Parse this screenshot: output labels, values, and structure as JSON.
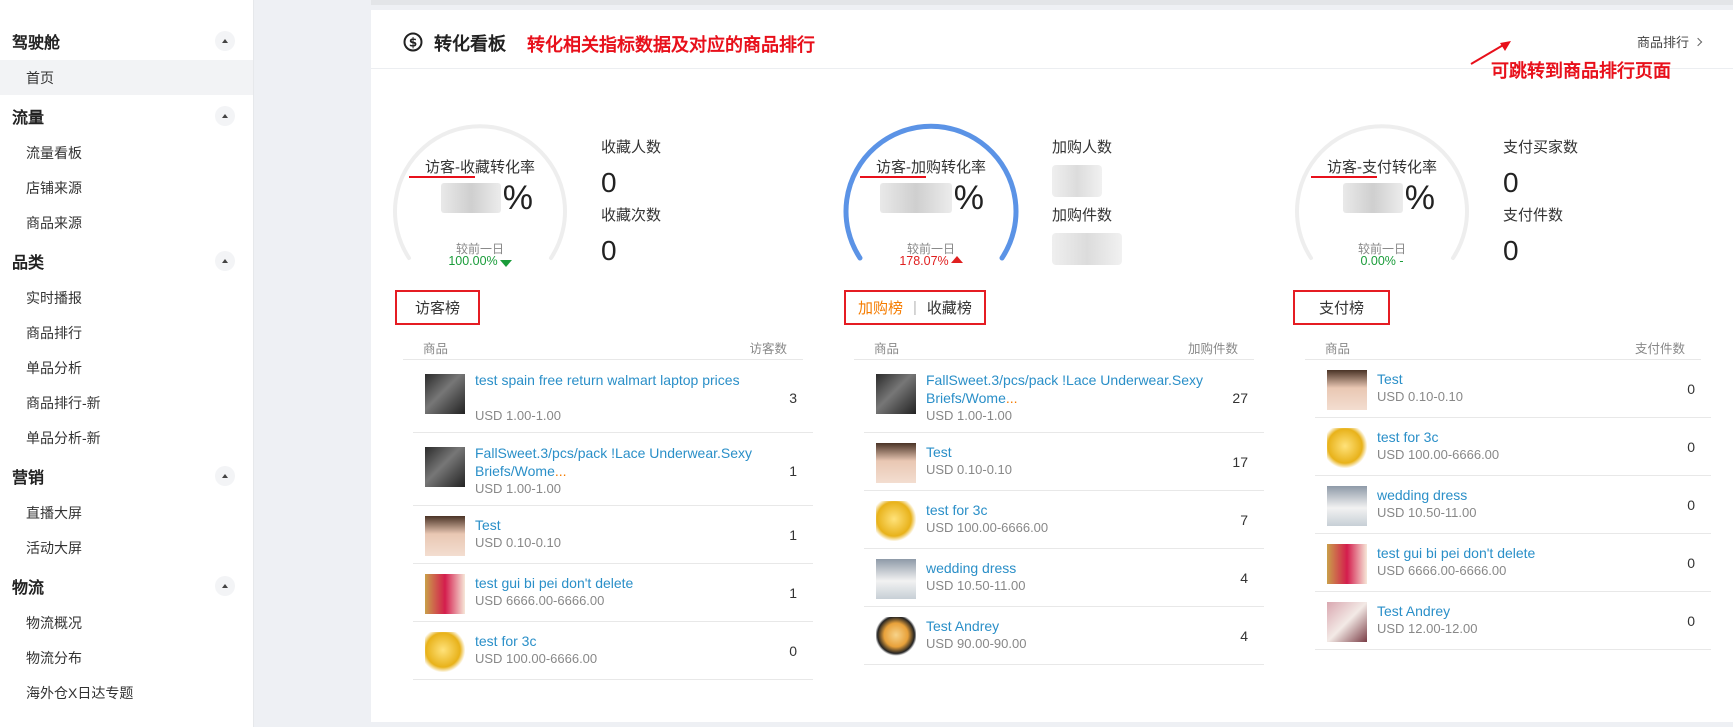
{
  "sidebar": {
    "groups": [
      {
        "label": "驾驶舱",
        "items": [
          "首页"
        ]
      },
      {
        "label": "流量",
        "items": [
          "流量看板",
          "店铺来源",
          "商品来源"
        ]
      },
      {
        "label": "品类",
        "items": [
          "实时播报",
          "商品排行",
          "单品分析",
          "商品排行-新",
          "单品分析-新"
        ]
      },
      {
        "label": "营销",
        "items": [
          "直播大屏",
          "活动大屏"
        ]
      },
      {
        "label": "物流",
        "items": [
          "物流概况",
          "物流分布",
          "海外仓X日达专题"
        ]
      }
    ],
    "active_item": "首页"
  },
  "card": {
    "title": "转化看板",
    "annotation_title": "转化相关指标数据及对应的商品排行",
    "more_link": "商品排行",
    "annotation_link": "可跳转到商品排行页面"
  },
  "colors": {
    "accent_blue": "#5b93e6",
    "annotation_red": "#e8101b",
    "link_blue": "#2a8fc8",
    "tab_orange": "#f57c00",
    "green": "#1a9c3a",
    "red": "#e02020"
  },
  "columns": [
    {
      "gauge_label": "访客-收藏转化率",
      "percent_sign": "%",
      "compare_label": "较前一日",
      "compare_value": "100.00%",
      "compare_direction": "down",
      "metric1_label": "收藏人数",
      "metric1_value": "0",
      "metric2_label": "收藏次数",
      "metric2_value": "0",
      "tabs": [
        "访客榜"
      ],
      "col_product": "商品",
      "col_count": "访客数",
      "rows": [
        {
          "name": "test spain free return walmart laptop prices",
          "price": "USD 1.00-1.00",
          "count": "3",
          "thumb": "dark"
        },
        {
          "name": "FallSweet.3/pcs/pack !Lace Underwear.Sexy Briefs/Wome",
          "ellipsis": "...",
          "price": "USD 1.00-1.00",
          "count": "1",
          "thumb": "dark"
        },
        {
          "name": "Test",
          "price": "USD 0.10-0.10",
          "count": "1",
          "thumb": "girl"
        },
        {
          "name": "test gui bi pei don't delete",
          "price": "USD 6666.00-6666.00",
          "count": "1",
          "thumb": "dress"
        },
        {
          "name": "test for 3c",
          "price": "USD 100.00-6666.00",
          "count": "0",
          "thumb": "gold"
        }
      ]
    },
    {
      "gauge_label": "访客-加购转化率",
      "percent_sign": "%",
      "compare_label": "较前一日",
      "compare_value": "178.07%",
      "compare_direction": "up",
      "metric1_label": "加购人数",
      "metric2_label": "加购件数",
      "tabs": [
        "加购榜",
        "收藏榜"
      ],
      "tab_separator": "|",
      "col_product": "商品",
      "col_count": "加购件数",
      "rows": [
        {
          "name": "FallSweet.3/pcs/pack !Lace Underwear.Sexy Briefs/Wome",
          "ellipsis": "...",
          "price": "USD 1.00-1.00",
          "count": "27",
          "thumb": "dark"
        },
        {
          "name": "Test",
          "price": "USD 0.10-0.10",
          "count": "17",
          "thumb": "girl"
        },
        {
          "name": "test for 3c",
          "price": "USD 100.00-6666.00",
          "count": "7",
          "thumb": "gold"
        },
        {
          "name": "wedding dress",
          "price": "USD 10.50-11.00",
          "count": "4",
          "thumb": "wed"
        },
        {
          "name": "Test Andrey",
          "price": "USD 90.00-90.00",
          "count": "4",
          "thumb": "cartoon"
        }
      ]
    },
    {
      "gauge_label": "访客-支付转化率",
      "percent_sign": "%",
      "compare_label": "较前一日",
      "compare_value": "0.00% -",
      "compare_direction": "flat",
      "metric1_label": "支付买家数",
      "metric1_value": "0",
      "metric2_label": "支付件数",
      "metric2_value": "0",
      "tabs": [
        "支付榜"
      ],
      "col_product": "商品",
      "col_count": "支付件数",
      "rows": [
        {
          "name": "Test",
          "price": "USD 0.10-0.10",
          "count": "0",
          "thumb": "girl"
        },
        {
          "name": "test for 3c",
          "price": "USD 100.00-6666.00",
          "count": "0",
          "thumb": "gold"
        },
        {
          "name": "wedding dress",
          "price": "USD 10.50-11.00",
          "count": "0",
          "thumb": "wed"
        },
        {
          "name": "test gui bi pei don't delete",
          "price": "USD 6666.00-6666.00",
          "count": "0",
          "thumb": "dress"
        },
        {
          "name": "Test Andrey",
          "price": "USD 12.00-12.00",
          "count": "0",
          "thumb": "bags"
        }
      ]
    }
  ]
}
